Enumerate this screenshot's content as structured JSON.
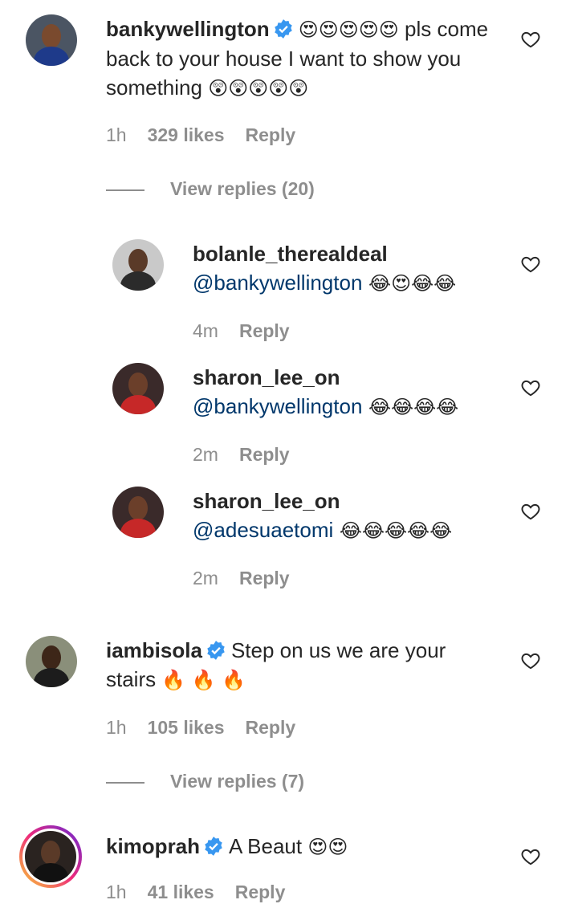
{
  "comments": [
    {
      "username": "bankywellington",
      "verified": true,
      "emoji_prefix": "😍😍😍😍😍",
      "text": " pls come back to your house I want to show you something ",
      "emoji_suffix": "😲😲😲😲😲",
      "time": "1h",
      "likes": "329 likes",
      "reply_label": "Reply",
      "view_replies": "View replies (20)"
    },
    {
      "username": "iambisola",
      "verified": true,
      "text": "Step on us we are your stairs ",
      "emoji_suffix": "🔥 🔥 🔥",
      "time": "1h",
      "likes": "105 likes",
      "reply_label": "Reply",
      "view_replies": "View replies (7)"
    },
    {
      "username": "kimoprah",
      "verified": true,
      "text": "A Beaut ",
      "emoji_suffix": "😍😍",
      "time": "1h",
      "likes": "41 likes",
      "reply_label": "Reply"
    }
  ],
  "replies": [
    {
      "username": "bolanle_therealdeal",
      "mention": "@bankywellington",
      "emoji_suffix": " 😂😍😂😂",
      "time": "4m",
      "reply_label": "Reply"
    },
    {
      "username": "sharon_lee_on",
      "mention": "@bankywellington",
      "emoji_suffix": " 😂😂😂😂",
      "time": "2m",
      "reply_label": "Reply"
    },
    {
      "username": "sharon_lee_on",
      "mention": "@adesuaetomi",
      "emoji_suffix": " 😂😂😂😂😂",
      "time": "2m",
      "reply_label": "Reply"
    }
  ],
  "colors": {
    "text": "#262626",
    "secondary": "#8e8e8e",
    "mention": "#00376b",
    "verified": "#3897f0"
  },
  "icons": {
    "like": "heart-outline-icon",
    "verified": "verified-badge-icon"
  }
}
